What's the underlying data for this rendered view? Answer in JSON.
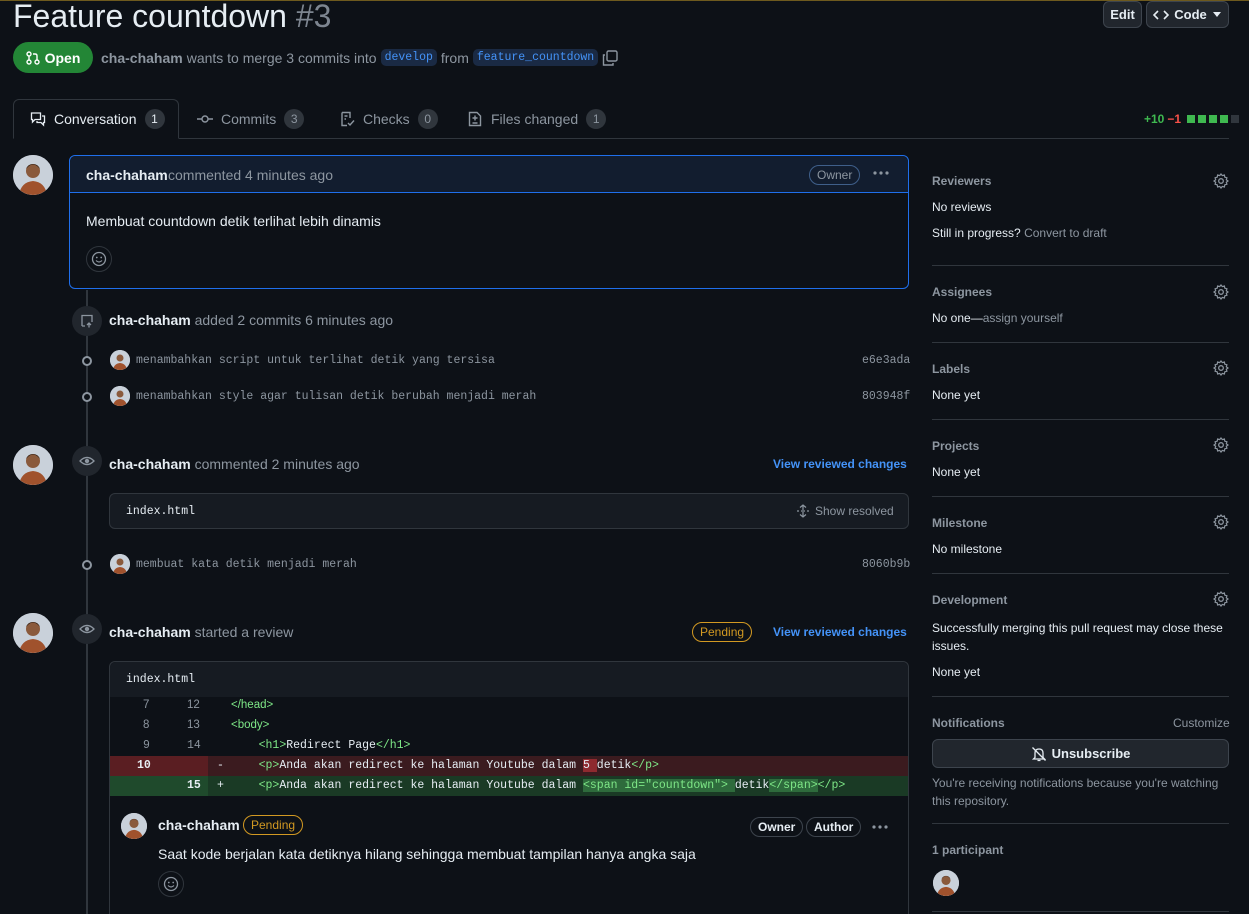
{
  "header": {
    "title": "Feature countdown",
    "number": "#3",
    "edit_label": "Edit",
    "code_label": "Code",
    "state": "Open",
    "author": "cha-chaham",
    "merge_text": "wants to merge 3 commits into",
    "base_branch": "develop",
    "from_text": "from",
    "head_branch": "feature_countdown"
  },
  "tabs": [
    {
      "label": "Conversation",
      "count": "1"
    },
    {
      "label": "Commits",
      "count": "3"
    },
    {
      "label": "Checks",
      "count": "0"
    },
    {
      "label": "Files changed",
      "count": "1"
    }
  ],
  "diffstat": {
    "additions": "+10",
    "deletions": "−1"
  },
  "comment1": {
    "author": "cha-chaham",
    "action": "commented 4 minutes ago",
    "badge": "Owner",
    "body": "Membuat countdown detik terlihat lebih dinamis"
  },
  "commits_event": {
    "author": "cha-chaham",
    "action": "added 2 commits 6 minutes ago",
    "commits": [
      {
        "message": "menambahkan script untuk terlihat detik yang tersisa",
        "sha": "e6e3ada"
      },
      {
        "message": "menambahkan style agar tulisan detik berubah menjadi merah",
        "sha": "803948f"
      }
    ]
  },
  "review1": {
    "author": "cha-chaham",
    "action": "commented 2 minutes ago",
    "view_changes": "View reviewed changes",
    "file": "index.html",
    "show_resolved": "Show resolved"
  },
  "commit3": {
    "message": "membuat kata detik menjadi merah",
    "sha": "8060b9b"
  },
  "review2": {
    "author": "cha-chaham",
    "action": "started a review",
    "pending": "Pending",
    "view_changes": "View reviewed changes",
    "file": "index.html",
    "diff": [
      {
        "old": "7",
        "new": "12",
        "sign": "",
        "code_pre": "",
        "tag_open": "</head>",
        "text": "",
        "tag_close": ""
      },
      {
        "old": "8",
        "new": "13",
        "sign": "",
        "code_pre": "",
        "tag_open": "<body>",
        "text": "",
        "tag_close": ""
      },
      {
        "old": "9",
        "new": "14",
        "sign": "",
        "code_pre": "    ",
        "tag_open": "<h1>",
        "text": "Redirect Page",
        "tag_close": "</h1>"
      },
      {
        "old": "10",
        "new": "",
        "sign": "-",
        "code_pre": "    ",
        "tag_open": "<p>",
        "text": "Anda akan redirect ke halaman Youtube dalam ",
        "highlight": "5 ",
        "text2": "detik",
        "tag_close": "</p>"
      },
      {
        "old": "",
        "new": "15",
        "sign": "+",
        "code_pre": "    ",
        "tag_open": "<p>",
        "text": "Anda akan redirect ke halaman Youtube dalam ",
        "highlight": "<span id=\"countdown\"> ",
        "text2": "detik",
        "highlight2": "</span>",
        "tag_close": "</p>"
      }
    ],
    "reply": {
      "author": "cha-chaham",
      "pending": "Pending",
      "owner": "Owner",
      "author_badge": "Author",
      "body": "Saat kode berjalan kata detiknya hilang sehingga membuat tampilan hanya angka saja"
    }
  },
  "sidebar": {
    "reviewers": {
      "title": "Reviewers",
      "value": "No reviews",
      "progress": "Still in progress?",
      "draft": "Convert to draft"
    },
    "assignees": {
      "title": "Assignees",
      "value": "No one—",
      "assign": "assign yourself"
    },
    "labels": {
      "title": "Labels",
      "value": "None yet"
    },
    "projects": {
      "title": "Projects",
      "value": "None yet"
    },
    "milestone": {
      "title": "Milestone",
      "value": "No milestone"
    },
    "development": {
      "title": "Development",
      "text": "Successfully merging this pull request may close these issues.",
      "value": "None yet"
    },
    "notifications": {
      "title": "Notifications",
      "customize": "Customize",
      "unsubscribe": "Unsubscribe",
      "reason": "You're receiving notifications because you're watching this repository."
    },
    "participants": {
      "title": "1 participant"
    }
  },
  "colors": {
    "background": "#0d1117",
    "accent": "#4493f8",
    "open": "#238636",
    "pending": "#d29922"
  }
}
